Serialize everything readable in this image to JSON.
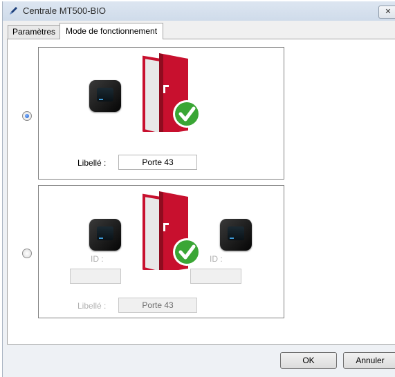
{
  "window": {
    "title": "Centrale MT500-BIO",
    "close_glyph": "✕",
    "icon": "pen-icon"
  },
  "tabs": [
    {
      "label": "Paramètres",
      "active": false
    },
    {
      "label": "Mode de fonctionnement",
      "active": true
    }
  ],
  "options": [
    {
      "selected": true,
      "libelle_label": "Libellé :",
      "libelle_value": "Porte 43"
    },
    {
      "selected": false,
      "id_left_label": "ID :",
      "id_left_value": "",
      "id_right_label": "ID :",
      "id_right_value": "",
      "libelle_label": "Libellé :",
      "libelle_value": "Porte 43"
    }
  ],
  "buttons": {
    "ok": "OK",
    "cancel": "Annuler"
  },
  "colors": {
    "door_red": "#c8102e",
    "check_green": "#3aa635",
    "radio_blue": "#1f5fc9"
  }
}
